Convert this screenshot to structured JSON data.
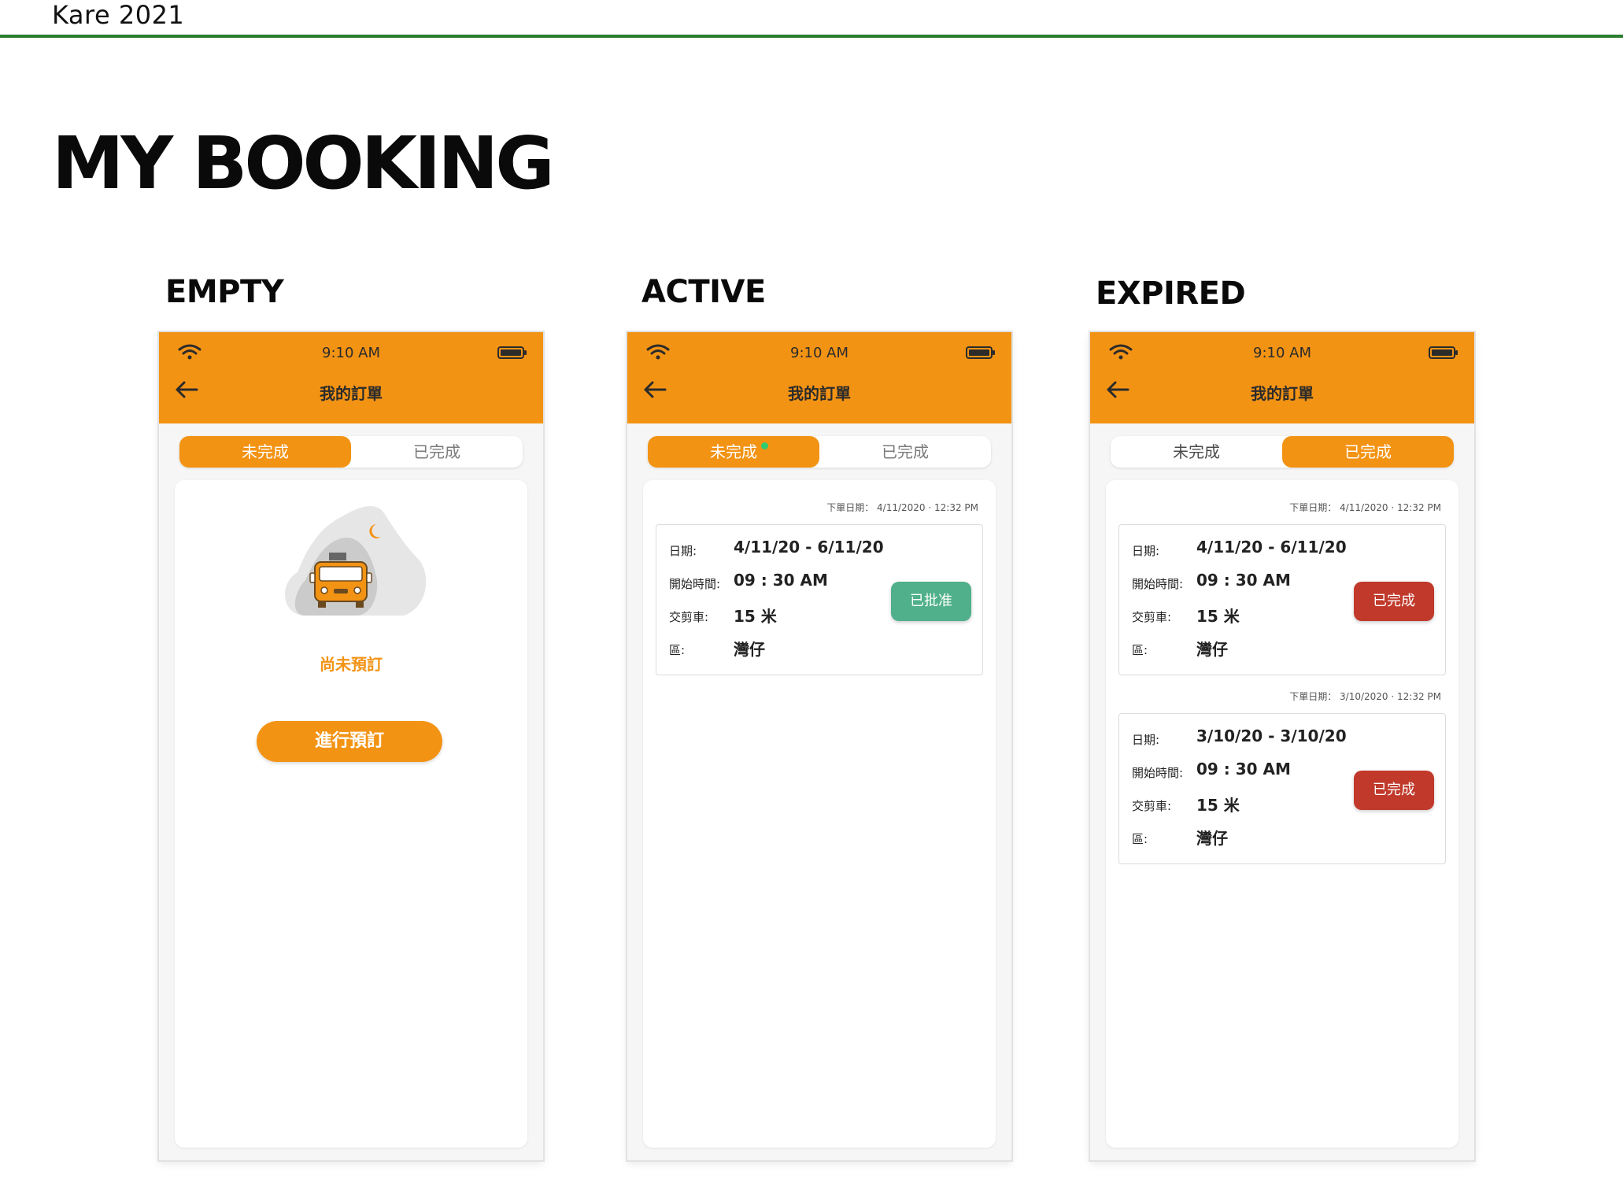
{
  "doc": {
    "brand": "Kare 2021",
    "title": "MY BOOKING"
  },
  "colors": {
    "accent": "#f39314",
    "approved": "#4fb08b",
    "completed": "#c0392b",
    "rule": "#2a7d2e",
    "dot": "#2ecc71"
  },
  "phone": {
    "time": "9:10 AM",
    "title": "我的訂單",
    "tab_pending": "未完成",
    "tab_done": "已完成"
  },
  "labels": {
    "date": "日期:",
    "start": "開始時間:",
    "vehicle": "交剪車:",
    "district": "區:"
  },
  "sections": {
    "empty": {
      "label": "EMPTY",
      "active_tab": "pending",
      "message": "尚未預訂",
      "button": "進行預訂"
    },
    "active": {
      "label": "ACTIVE",
      "active_tab": "pending",
      "orders": [
        {
          "meta": "下單日期： 4/11/2020 ·  12:32 PM",
          "date": "4/11/20  -  6/11/20",
          "start": "09 : 30 AM",
          "vehicle": "15 米",
          "district": "灣仔",
          "status": "已批准"
        }
      ]
    },
    "expired": {
      "label": "EXPIRED",
      "active_tab": "done",
      "orders": [
        {
          "meta": "下單日期： 4/11/2020 ·  12:32 PM",
          "date": "4/11/20  -  6/11/20",
          "start": "09 : 30 AM",
          "vehicle": "15 米",
          "district": "灣仔",
          "status": "已完成"
        },
        {
          "meta": "下單日期： 3/10/2020 ·  12:32 PM",
          "date": "3/10/20  -  3/10/20",
          "start": "09 : 30 AM",
          "vehicle": "15 米",
          "district": "灣仔",
          "status": "已完成"
        }
      ]
    }
  }
}
